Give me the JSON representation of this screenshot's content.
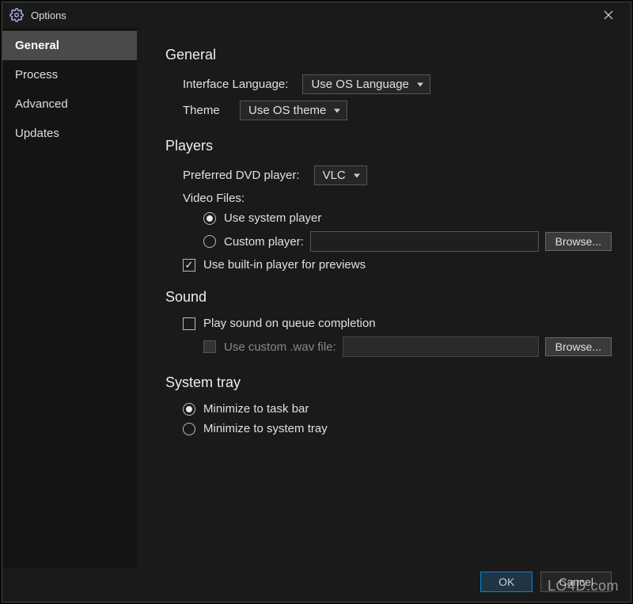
{
  "window": {
    "title": "Options"
  },
  "sidebar": {
    "items": [
      {
        "label": "General",
        "active": true
      },
      {
        "label": "Process",
        "active": false
      },
      {
        "label": "Advanced",
        "active": false
      },
      {
        "label": "Updates",
        "active": false
      }
    ]
  },
  "general": {
    "heading": "General",
    "language_label": "Interface Language:",
    "language_value": "Use OS Language",
    "theme_label": "Theme",
    "theme_value": "Use OS theme"
  },
  "players": {
    "heading": "Players",
    "dvd_label": "Preferred DVD player:",
    "dvd_value": "VLC",
    "video_files_label": "Video Files:",
    "radio_system": "Use system player",
    "radio_custom": "Custom player:",
    "custom_value": "",
    "browse_label": "Browse...",
    "builtin_preview": "Use built-in player for previews",
    "builtin_checked": true,
    "selected": "system"
  },
  "sound": {
    "heading": "Sound",
    "play_on_complete": "Play sound on queue completion",
    "play_checked": false,
    "use_custom_wav": "Use custom .wav file:",
    "wav_enabled": false,
    "wav_value": "",
    "browse_label": "Browse..."
  },
  "systray": {
    "heading": "System tray",
    "radio_taskbar": "Minimize to task bar",
    "radio_tray": "Minimize to system tray",
    "selected": "taskbar"
  },
  "footer": {
    "ok": "OK",
    "cancel": "Cancel"
  },
  "watermark": "LO4D.com"
}
